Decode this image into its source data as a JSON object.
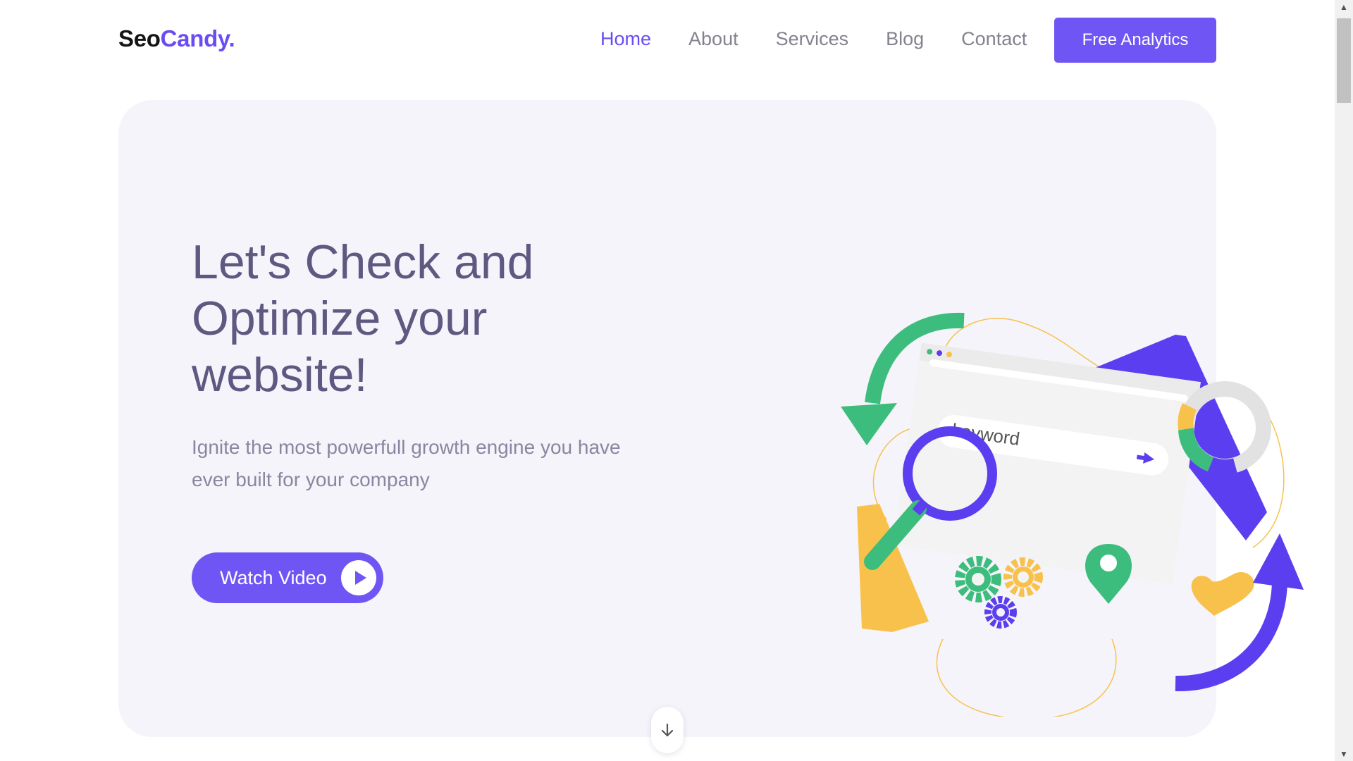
{
  "brand": {
    "part1": "Seo",
    "part2": "Candy."
  },
  "nav": {
    "items": [
      {
        "label": "Home",
        "active": true
      },
      {
        "label": "About",
        "active": false
      },
      {
        "label": "Services",
        "active": false
      },
      {
        "label": "Blog",
        "active": false
      },
      {
        "label": "Contact",
        "active": false
      }
    ],
    "cta_label": "Free Analytics"
  },
  "hero": {
    "title": "Let's Check and Optimize your website!",
    "subtitle": "Ignite the most powerfull growth engine you have ever built for your company",
    "watch_label": "Watch Video",
    "search_keyword": "keyword"
  },
  "icons": {
    "play": "play-icon",
    "scroll": "arrow-down-icon",
    "search": "magnifier-icon"
  },
  "colors": {
    "accent": "#6f56f4",
    "green": "#3dbd7d",
    "yellow": "#f8c14b",
    "title": "#5f5881"
  }
}
